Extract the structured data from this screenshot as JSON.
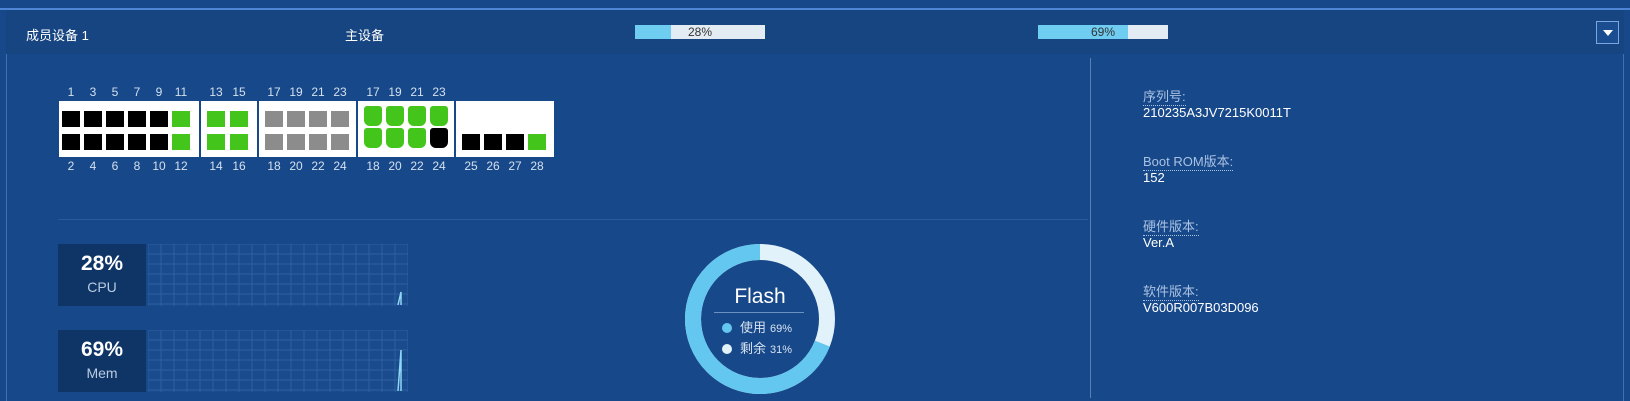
{
  "header": {
    "member": "成员设备 1",
    "role": "主设备",
    "cpu_bar": {
      "percent": 28,
      "label": "28%"
    },
    "mem_bar": {
      "percent": 69,
      "label": "69%"
    },
    "toggle_icon": "chevron-down-icon"
  },
  "ports": {
    "top_numbers": [
      "1",
      "3",
      "5",
      "7",
      "9",
      "11",
      "13",
      "15",
      "17",
      "19",
      "21",
      "23",
      "17",
      "19",
      "21",
      "23"
    ],
    "bottom_numbers": [
      "2",
      "4",
      "6",
      "8",
      "10",
      "12",
      "14",
      "16",
      "18",
      "20",
      "22",
      "24",
      "18",
      "20",
      "22",
      "24",
      "25",
      "26",
      "27",
      "28"
    ],
    "groups": [
      {
        "top": [
          "off",
          "off",
          "off",
          "off",
          "off",
          "up"
        ],
        "bottom": [
          "off",
          "off",
          "off",
          "off",
          "off",
          "up"
        ]
      },
      {
        "top": [
          "up",
          "up"
        ],
        "bottom": [
          "up",
          "up"
        ]
      },
      {
        "top": [
          "gray",
          "gray",
          "gray",
          "gray"
        ],
        "bottom": [
          "gray",
          "gray",
          "gray",
          "gray"
        ]
      },
      {
        "top": [
          "up",
          "up",
          "up",
          "up"
        ],
        "bottom": [
          "up",
          "up",
          "up",
          "off"
        ]
      },
      {
        "top": [],
        "bottom": [
          "off",
          "off",
          "off",
          "up"
        ]
      }
    ],
    "status_colors": {
      "up": "#44c51c",
      "off": "#000000",
      "gray": "#8c8c8c"
    }
  },
  "cpu": {
    "value": "28%",
    "label": "CPU"
  },
  "mem": {
    "value": "69%",
    "label": "Mem"
  },
  "flash": {
    "title": "Flash",
    "used_label": "使用",
    "used_pct": "69%",
    "used_value": 69,
    "free_label": "剩余",
    "free_pct": "31%",
    "free_value": 31,
    "colors": {
      "used": "#64c7ef",
      "free": "#e1f2fb"
    }
  },
  "info": [
    {
      "label": "序列号:",
      "value": "210235A3JV7215K0011T"
    },
    {
      "label": "Boot ROM版本:",
      "value": "152"
    },
    {
      "label": "硬件版本:",
      "value": "Ver.A"
    },
    {
      "label": "软件版本:",
      "value": "V600R007B03D096"
    }
  ]
}
